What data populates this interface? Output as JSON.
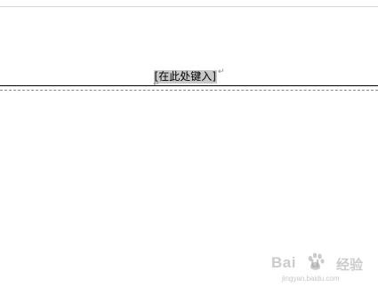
{
  "header": {
    "placeholder_text": "[在此处键入]",
    "paragraph_mark": "↵"
  },
  "watermark": {
    "brand_latin": "Bai",
    "brand_latin_end": "u",
    "brand_cn": "经验",
    "url": "jingyan.baidu.com"
  },
  "colors": {
    "placeholder_bg": "#c9c9c9",
    "mark_color": "#8a8a8a",
    "watermark": "#a0a0a0"
  }
}
